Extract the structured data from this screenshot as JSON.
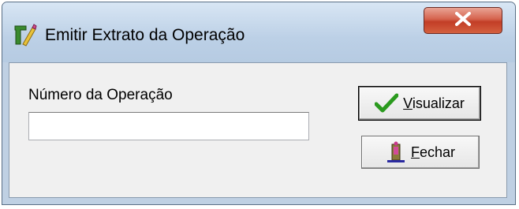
{
  "window": {
    "title": "Emitir Extrato da Operação",
    "app_icon": "tool-pencil-icon",
    "close_label": "X"
  },
  "form": {
    "label": "Número da Operação",
    "operation_number_value": "",
    "operation_number_placeholder": ""
  },
  "buttons": {
    "view": {
      "mnemonic": "V",
      "rest": "isualizar",
      "icon": "checkmark-icon"
    },
    "close": {
      "mnemonic": "F",
      "rest": "echar",
      "icon": "door-exit-icon"
    }
  },
  "colors": {
    "titlebar": "#bcd0e6",
    "close_button": "#c23d26",
    "client_area": "#f0f0f0",
    "checkmark": "#2a9a1e"
  }
}
